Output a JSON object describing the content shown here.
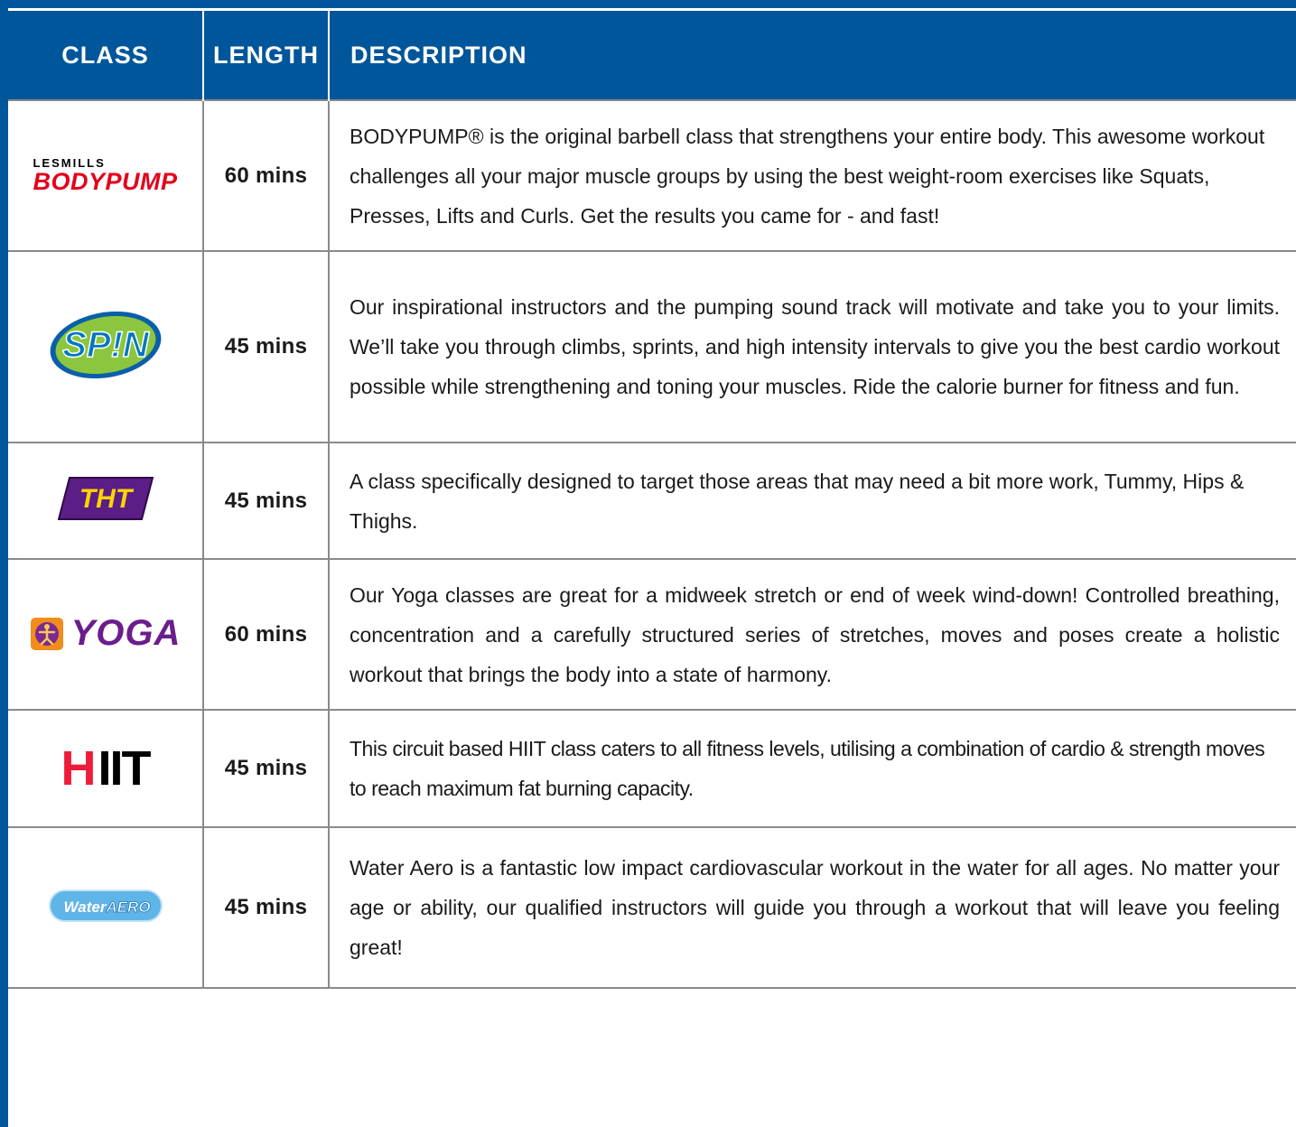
{
  "table": {
    "headers": {
      "class": "CLASS",
      "length": "LENGTH",
      "description": "DESCRIPTION"
    },
    "rows": [
      {
        "logo": {
          "name": "bodypump-logo",
          "line1": "LESMILLS",
          "line2": "BODYPUMP"
        },
        "length": "60 mins",
        "description": "BODYPUMP® is the original barbell class that strengthens your entire body. This awesome workout challenges all your major muscle groups by using the best weight-room exercises like Squats, Presses, Lifts and Curls.  Get the results you came for - and fast!"
      },
      {
        "logo": {
          "name": "spin-logo",
          "text": "SP!N"
        },
        "length": "45 mins",
        "description": "Our inspirational instructors and the pumping sound track will motivate and take you to your limits. We’ll take you through climbs, sprints, and high intensity intervals to give you the best cardio workout possible while strengthening and toning your muscles.  Ride the calorie burner for fitness and fun."
      },
      {
        "logo": {
          "name": "tht-logo",
          "text": "THT"
        },
        "length": "45 mins",
        "description": "A class specifically designed to target those areas that may need a bit more work, Tummy, Hips & Thighs."
      },
      {
        "logo": {
          "name": "yoga-logo",
          "text": "YOGA"
        },
        "length": "60 mins",
        "description": "Our Yoga classes are great for a midweek stretch or end of week wind-down! Controlled breathing, concentration and a carefully structured series of stretches, moves and poses create a holistic workout that brings the body into a state of harmony."
      },
      {
        "logo": {
          "name": "hiit-logo",
          "part1": "H",
          "part2": "IIT"
        },
        "length": "45 mins",
        "description": "This circuit based HIIT class caters to all fitness levels, utilising a combination of cardio & strength moves to reach maximum fat burning capacity."
      },
      {
        "logo": {
          "name": "water-aero-logo",
          "part1": "Water",
          "part2": "AERO"
        },
        "length": "45 mins",
        "description": "Water Aero is a fantastic low impact cardiovascular workout in the water for all ages. No matter your age or ability, our qualified instructors will guide you through a workout that will leave you feeling great!"
      }
    ]
  },
  "colors": {
    "header_blue": "#00569a",
    "grid_gray": "#8a8a8a",
    "bodypump_red": "#e3001b",
    "spin_green": "#8cc63f",
    "spin_blue": "#0077c0",
    "tht_purple": "#5b1d86",
    "tht_yellow": "#ffd400",
    "yoga_purple": "#6b1d8c",
    "yoga_orange": "#f28c1c",
    "hiit_red": "#ed1c3a",
    "water_blue": "#5fb4e8"
  }
}
